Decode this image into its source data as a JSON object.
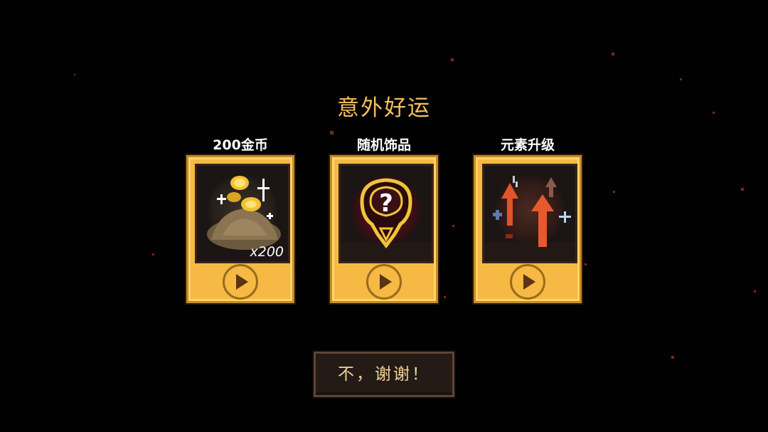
{
  "title": "意外好运",
  "cards": [
    {
      "label": "200金币",
      "amount": "x200",
      "art_icon": "gold-coin-pile-icon",
      "play_icon": "play-icon"
    },
    {
      "label": "随机饰品",
      "art_icon": "mystery-trinket-icon",
      "play_icon": "play-icon"
    },
    {
      "label": "元素升级",
      "art_icon": "element-upgrade-arrows-icon",
      "play_icon": "play-icon"
    }
  ],
  "decline_button": "不，谢谢！",
  "colors": {
    "background": "#020101",
    "title": "#f2c15a",
    "card_gold": "#f5b944",
    "card_border": "#c78a24",
    "button_dark": "#241a16",
    "ember": "#7a2a16"
  }
}
